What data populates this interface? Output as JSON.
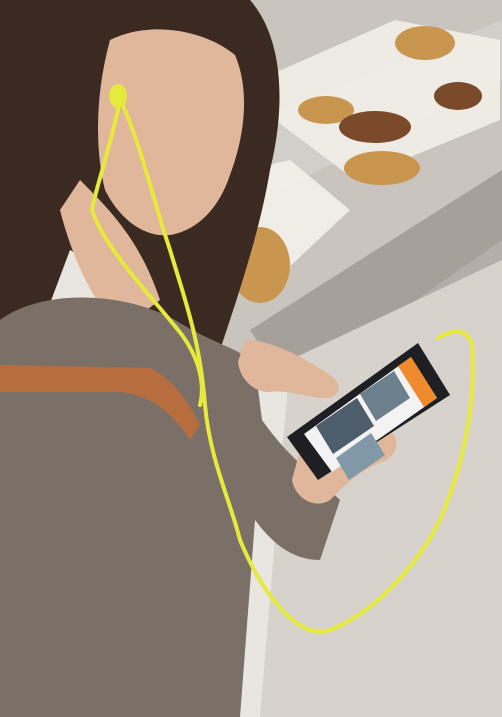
{
  "scene": {
    "palette": {
      "background": "#e9e6e1",
      "counter_glass": "#c7c2bb",
      "counter_shadow": "#8f8983",
      "sweater": "#7a7068",
      "hair": "#3b2a22",
      "skin": "#e0b79a",
      "earbud_cable": "#e6ea3c",
      "bag_strap": "#b86d3f",
      "phone_body": "#1d1f22",
      "app_header": "#f08b2d",
      "pastry_light": "#c9964f",
      "pastry_dark": "#7a4a2a"
    },
    "icons": {
      "phone": "smartphone-icon",
      "earphones": "earphones-icon"
    }
  }
}
